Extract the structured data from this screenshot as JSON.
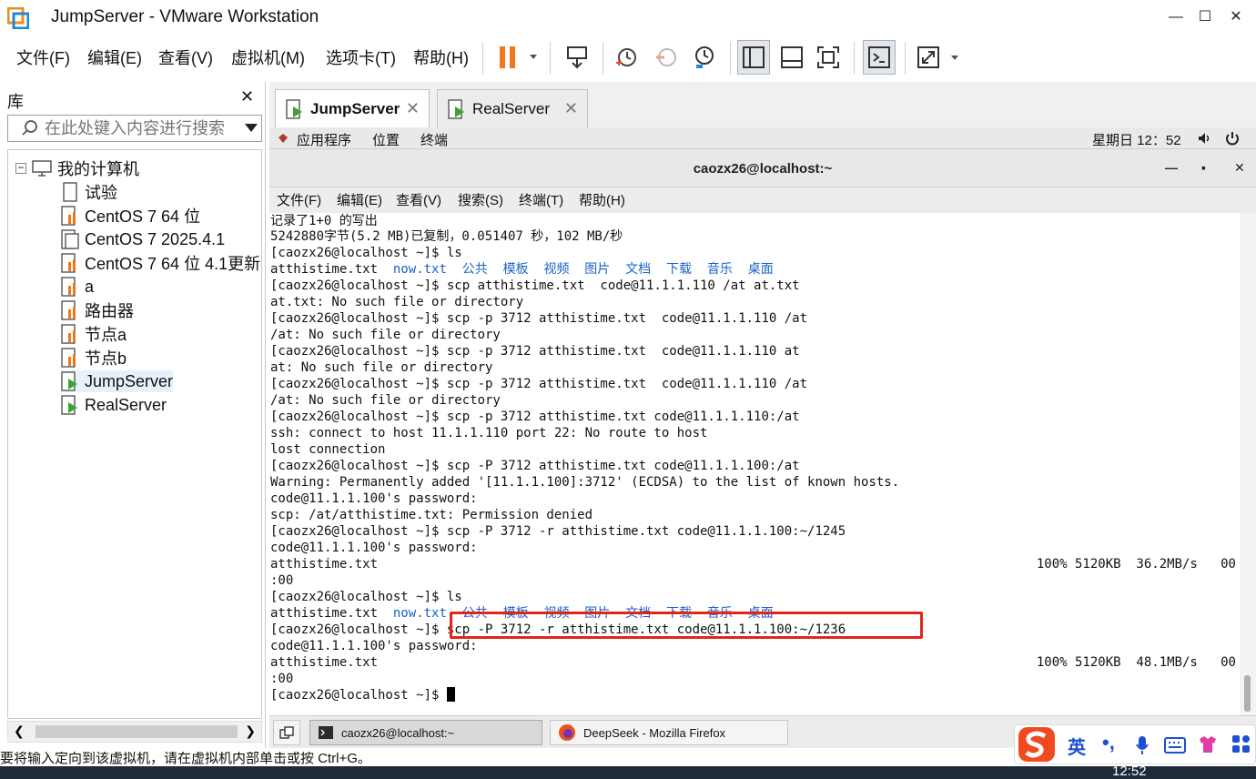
{
  "window": {
    "title": "JumpServer - VMware Workstation"
  },
  "vmware_menu": {
    "items": [
      "文件(F)",
      "编辑(E)",
      "查看(V)",
      "虚拟机(M)",
      "选项卡(T)",
      "帮助(H)"
    ]
  },
  "library": {
    "title": "库",
    "search_placeholder": "在此处键入内容进行搜索",
    "root": "我的计算机",
    "items": [
      "试验",
      "CentOS 7 64 位",
      "CentOS 7 2025.4.1",
      "CentOS 7 64 位 4.1更新",
      "a",
      "路由器",
      "节点a",
      "节点b",
      "JumpServer",
      "RealServer"
    ],
    "selected": "JumpServer"
  },
  "vm_tabs": [
    {
      "label": "JumpServer",
      "active": true
    },
    {
      "label": "RealServer",
      "active": false
    }
  ],
  "gnome_bar": {
    "apps": "应用程序",
    "places": "位置",
    "terminal": "终端",
    "clock": "星期日 12：52"
  },
  "terminal": {
    "title": "caozx26@localhost:~",
    "menu": [
      "文件(F)",
      "编辑(E)",
      "查看(V)",
      "搜索(S)",
      "终端(T)",
      "帮助(H)"
    ],
    "lines": [
      "记录了1+0 的写出",
      "5242880字节(5.2 MB)已复制，0.051407 秒，102 MB/秒",
      "[caozx26@localhost ~]$ ls",
      "atthistime.txt",
      "[caozx26@localhost ~]$ scp atthistime.txt  code@11.1.1.110 /at at.txt",
      "at.txt: No such file or directory",
      "[caozx26@localhost ~]$ scp -p 3712 atthistime.txt  code@11.1.1.110 /at",
      "/at: No such file or directory",
      "[caozx26@localhost ~]$ scp -p 3712 atthistime.txt  code@11.1.1.110 at",
      "at: No such file or directory",
      "[caozx26@localhost ~]$ scp -p 3712 atthistime.txt  code@11.1.1.110 /at",
      "/at: No such file or directory",
      "[caozx26@localhost ~]$ scp -p 3712 atthistime.txt code@11.1.1.110:/at",
      "ssh: connect to host 11.1.1.110 port 22: No route to host",
      "lost connection",
      "[caozx26@localhost ~]$ scp -P 3712 atthistime.txt code@11.1.1.100:/at",
      "Warning: Permanently added '[11.1.1.100]:3712' (ECDSA) to the list of known hosts.",
      "code@11.1.1.100's password:",
      "scp: /at/atthistime.txt: Permission denied",
      "[caozx26@localhost ~]$ scp -P 3712 -r atthistime.txt code@11.1.1.100:~/1245",
      "code@11.1.1.100's password:",
      "atthistime.txt",
      ":00",
      "[caozx26@localhost ~]$ ls",
      "atthistime.txt",
      "[caozx26@localhost ~]$ scp -P 3712 -r atthistime.txt code@11.1.1.100:~/1236",
      "code@11.1.1.100's password:",
      "atthistime.txt",
      ":00",
      "[caozx26@localhost ~]$ "
    ],
    "ls_dirs": "now.txt  公共  模板  视频  图片  文档  下载  音乐  桌面",
    "progress1": "100% 5120KB  36.2MB/s   00",
    "progress2": "100% 5120KB  48.1MB/s   00"
  },
  "guest_taskbar": {
    "items": [
      "caozx26@localhost:~",
      "DeepSeek - Mozilla Firefox"
    ]
  },
  "ime": {
    "lang": "英"
  },
  "status": {
    "text": "要将输入定向到该虚拟机，请在虚拟机内部单击或按 Ctrl+G。"
  },
  "host_clock": "12:52",
  "colors": {
    "highlight": "#e3241b",
    "ls_blue": "#1a63c7",
    "pause": "#f0771b"
  }
}
